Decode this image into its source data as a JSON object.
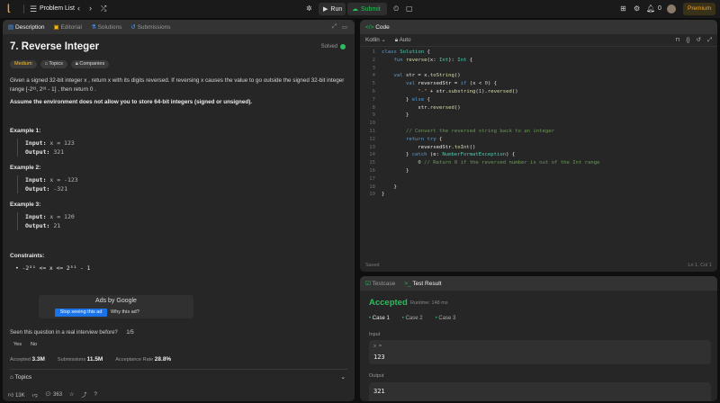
{
  "topbar": {
    "logo": "leetcode-logo",
    "problem_list": "Problem List",
    "run": "Run",
    "submit": "Submit",
    "notif_count": "0",
    "premium": "Premium"
  },
  "left": {
    "tabs": [
      "Description",
      "Editorial",
      "Solutions",
      "Submissions"
    ],
    "title": "7. Reverse Integer",
    "status": "Solved",
    "difficulty": "Medium",
    "topics_tag": "Topics",
    "companies_tag": "Companies",
    "desc_line1": "Given a signed 32-bit integer  x , return  x  with its digits reversed. If reversing  x  causes the value to go outside the signed 32-bit integer",
    "desc_line2": "range  [-2³¹, 2³¹ - 1] , then return  0 .",
    "assume": "Assume the environment does not allow you to store 64-bit integers (signed or unsigned).",
    "examples": [
      {
        "title": "Example 1:",
        "input": "x = 123",
        "output": "321"
      },
      {
        "title": "Example 2:",
        "input": "x = -123",
        "output": "-321"
      },
      {
        "title": "Example 3:",
        "input": "x = 120",
        "output": "21"
      }
    ],
    "input_label": "Input:",
    "output_label": "Output:",
    "constraints_title": "Constraints:",
    "constraint": "-2³¹ <= x <= 2³¹ - 1",
    "ad_title": "Ads by Google",
    "ad_stop": "Stop seeing this ad",
    "ad_why": "Why this ad?",
    "seen_q": "Seen this question in a real interview before?",
    "seen_page": "1/5",
    "yes": "Yes",
    "no": "No",
    "accepted_label": "Accepted",
    "accepted_val": "3.3M",
    "submissions_label": "Submissions",
    "submissions_val": "11.5M",
    "rate_label": "Acceptance Rate",
    "rate_val": "28.8%",
    "topics_section": "Topics",
    "likes": "13K",
    "comments": "363"
  },
  "code": {
    "tab": "Code",
    "language": "Kotlin",
    "mode": "Auto",
    "saved": "Saved",
    "cursor": "Ln 1, Col 1",
    "lines": [
      "class Solution {",
      "    fun reverse(x: Int): Int {",
      "",
      "    val str = x.toString()",
      "        val reversedStr = if (x < 0) {",
      "            \"-\" + str.substring(1).reversed()",
      "        } else {",
      "            str.reversed()",
      "        }",
      "",
      "        // Convert the reversed string back to an integer",
      "        return try {",
      "            reversedStr.toInt()",
      "        } catch (e: NumberFormatException) {",
      "            0 // Return 0 if the reversed number is out of the Int range",
      "        }",
      "",
      "    }",
      "}"
    ]
  },
  "result": {
    "tabs": [
      "Testcase",
      "Test Result"
    ],
    "status": "Accepted",
    "runtime": "Runtime: 148 ms",
    "cases": [
      "Case 1",
      "Case 2",
      "Case 3"
    ],
    "input_label": "Input",
    "var": "x =",
    "input_val": "123",
    "output_label": "Output",
    "output_val": "321"
  }
}
